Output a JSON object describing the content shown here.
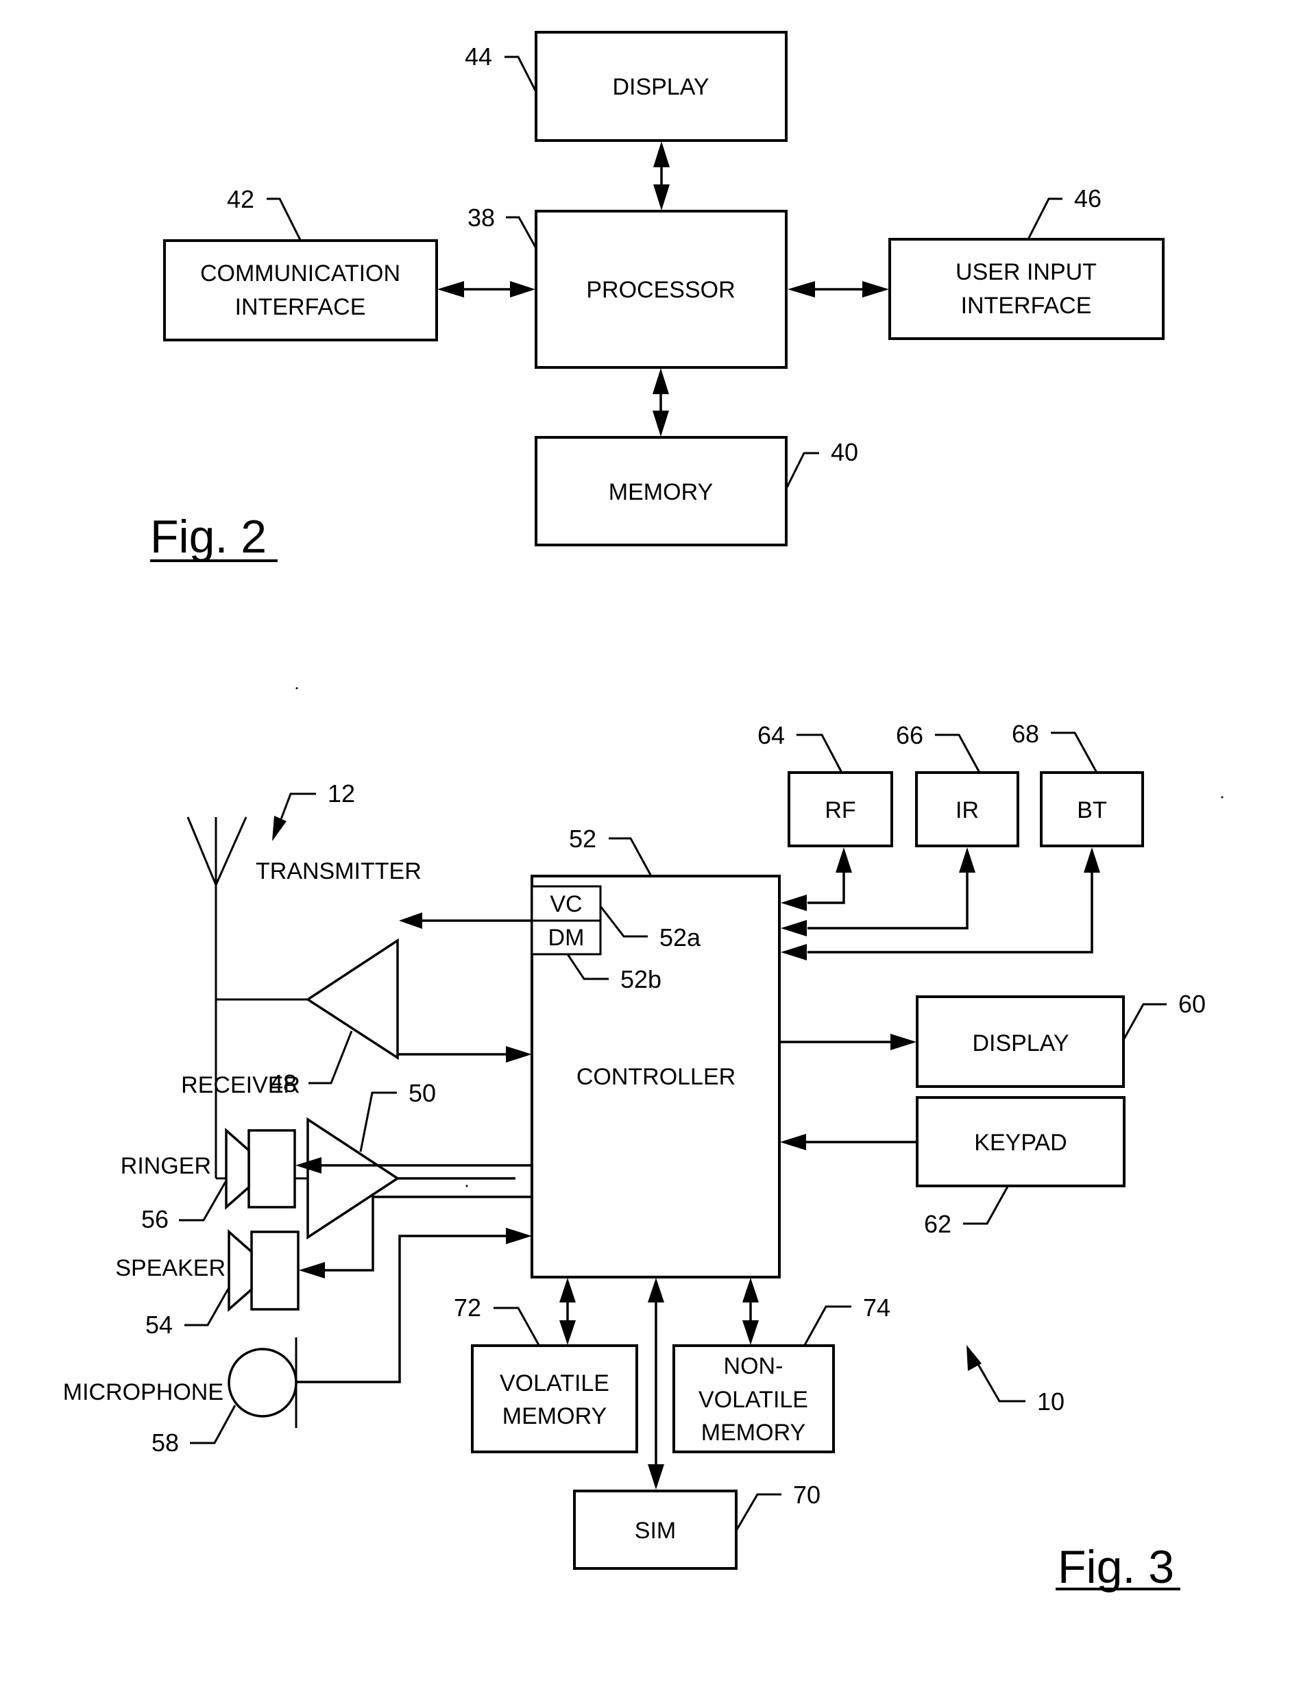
{
  "fig2": {
    "title": "Fig. 2",
    "display": {
      "label": "DISPLAY",
      "ref": "44"
    },
    "processor": {
      "label": "PROCESSOR",
      "ref": "38"
    },
    "communication_interface": {
      "label_line1": "COMMUNICATION",
      "label_line2": "INTERFACE",
      "ref": "42"
    },
    "user_input_interface": {
      "label_line1": "USER INPUT",
      "label_line2": "INTERFACE",
      "ref": "46"
    },
    "memory": {
      "label": "MEMORY",
      "ref": "40"
    }
  },
  "fig3": {
    "title": "Fig. 3",
    "device_ref": "10",
    "antenna_ref": "12",
    "transmitter": {
      "label": "TRANSMITTER",
      "ref": "48"
    },
    "receiver": {
      "label": "RECEIVER",
      "ref": "50"
    },
    "controller": {
      "label": "CONTROLLER",
      "ref": "52"
    },
    "vc": {
      "label": "VC",
      "ref": "52a"
    },
    "dm": {
      "label": "DM",
      "ref": "52b"
    },
    "rf": {
      "label": "RF",
      "ref": "64"
    },
    "ir": {
      "label": "IR",
      "ref": "66"
    },
    "bt": {
      "label": "BT",
      "ref": "68"
    },
    "display": {
      "label": "DISPLAY",
      "ref": "60"
    },
    "keypad": {
      "label": "KEYPAD",
      "ref": "62"
    },
    "ringer": {
      "label": "RINGER",
      "ref": "56"
    },
    "speaker": {
      "label": "SPEAKER",
      "ref": "54"
    },
    "microphone": {
      "label": "MICROPHONE",
      "ref": "58"
    },
    "volatile_memory": {
      "label_line1": "VOLATILE",
      "label_line2": "MEMORY",
      "ref": "72"
    },
    "non_volatile_memory": {
      "label_line1": "NON-",
      "label_line2": "VOLATILE",
      "label_line3": "MEMORY",
      "ref": "74"
    },
    "sim": {
      "label": "SIM",
      "ref": "70"
    }
  }
}
